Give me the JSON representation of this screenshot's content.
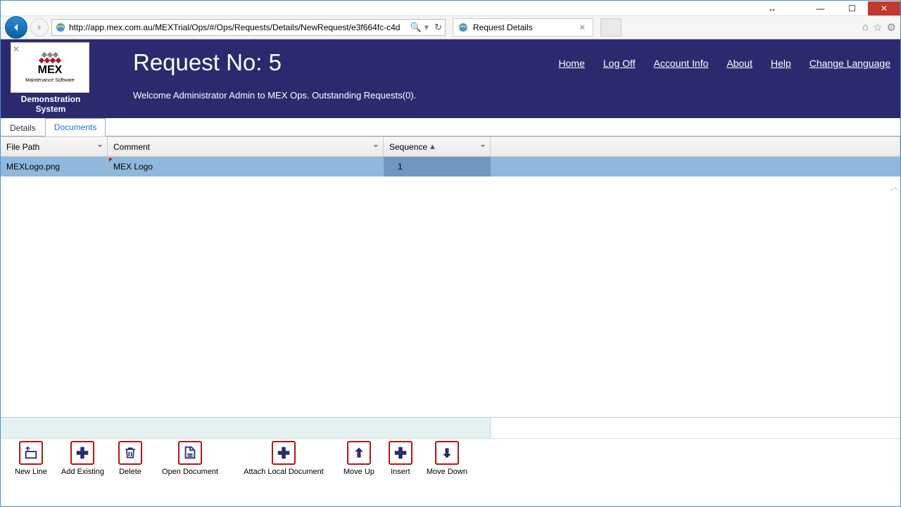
{
  "browser": {
    "url": "http://app.mex.com.au/MEXTrial/Ops/#/Ops/Requests/Details/NewRequest/e3f664fc-c4d",
    "tab_title": "Request Details"
  },
  "logo": {
    "name": "MEX",
    "sub": "Maintenance Software",
    "system_label": "Demonstration System"
  },
  "header": {
    "title": "Request No: 5",
    "welcome": "Welcome Administrator Admin to MEX Ops. Outstanding Requests(0).",
    "nav": {
      "home": "Home",
      "logoff": "Log Off",
      "account": "Account Info",
      "about": "About",
      "help": "Help",
      "lang": "Change Language"
    }
  },
  "tabs": {
    "details": "Details",
    "documents": "Documents"
  },
  "grid": {
    "headers": {
      "file": "File Path",
      "comment": "Comment",
      "seq": "Sequence"
    },
    "rows": [
      {
        "file": "MEXLogo.png",
        "comment": "MEX Logo",
        "seq": "1"
      }
    ]
  },
  "toolbar": {
    "newline": "New Line",
    "addexisting": "Add Existing",
    "delete": "Delete",
    "open": "Open Document",
    "attach": "Attach Local Document",
    "moveup": "Move Up",
    "insert": "Insert",
    "movedown": "Move Down"
  }
}
